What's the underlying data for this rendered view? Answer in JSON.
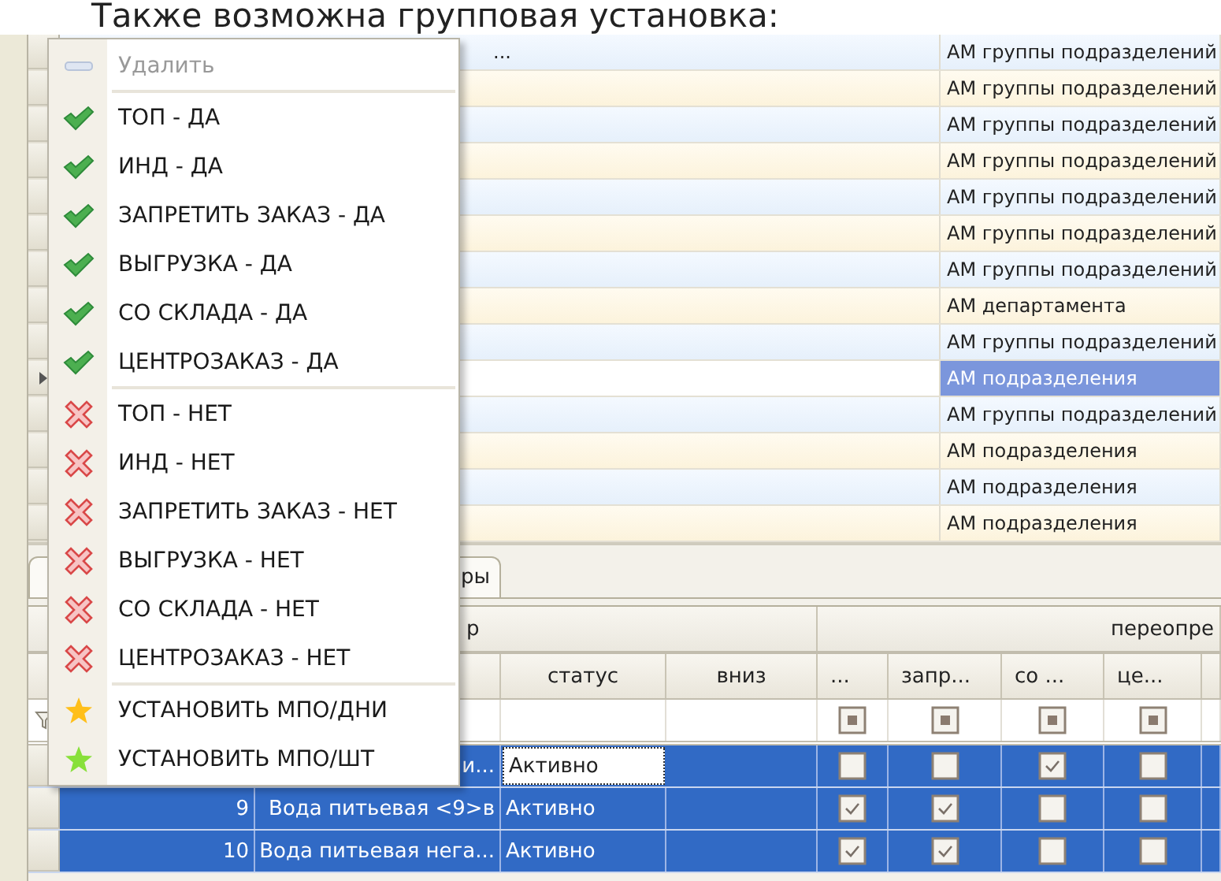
{
  "heading": "Также возможна групповая установка:",
  "top_grid": {
    "rows": [
      {
        "column_2": "...",
        "column_3": "АМ группы подразделений",
        "selected": false
      },
      {
        "column_3": "АМ группы подразделений",
        "selected": false
      },
      {
        "column_3": "АМ группы подразделений",
        "selected": false
      },
      {
        "column_3": "АМ группы подразделений",
        "selected": false
      },
      {
        "column_3": "АМ группы подразделений",
        "selected": false
      },
      {
        "column_3": "АМ группы подразделений",
        "selected": false
      },
      {
        "column_3": "АМ группы подразделений",
        "selected": false
      },
      {
        "column_3": "АМ департамента",
        "selected": false
      },
      {
        "column_3": "АМ группы подразделений",
        "selected": false
      },
      {
        "column_3": "АМ подразделения",
        "selected": true
      },
      {
        "column_3": "АМ группы подразделений",
        "selected": false
      },
      {
        "column_3": "АМ подразделения",
        "selected": false
      },
      {
        "column_3": "АМ подразделения",
        "selected": false
      },
      {
        "column_3": "АМ подразделения",
        "selected": false
      }
    ]
  },
  "tabs": [
    {
      "label": "ры",
      "selected": true
    }
  ],
  "bottom_grid": {
    "groups": [
      {
        "label": "р"
      },
      {
        "label": "переопре"
      }
    ],
    "columns": [
      "статус",
      "вниз",
      "...",
      "запр...",
      "со ...",
      "це..."
    ],
    "rows": [
      {
        "name": "и...",
        "status": "Активно",
        "editing": true,
        "selected": true,
        "checks": [
          false,
          false,
          true,
          false
        ]
      },
      {
        "number": "9",
        "name": "Вода питьевая  <9>в",
        "status": "Активно",
        "editing": false,
        "selected": true,
        "checks": [
          true,
          true,
          false,
          false
        ]
      },
      {
        "number": "10",
        "name": "Вода питьевая нега...",
        "status": "Активно",
        "editing": false,
        "selected": true,
        "checks": [
          true,
          true,
          false,
          false
        ]
      }
    ]
  },
  "context_menu": {
    "groups": [
      [
        {
          "label": "Удалить",
          "kind": "remove",
          "disabled": true
        }
      ],
      [
        {
          "label": "ТОП - ДА",
          "kind": "yes",
          "disabled": false
        },
        {
          "label": "ИНД - ДА",
          "kind": "yes",
          "disabled": false
        },
        {
          "label": "ЗАПРЕТИТЬ ЗАКАЗ - ДА",
          "kind": "yes",
          "disabled": false
        },
        {
          "label": "ВЫГРУЗКА - ДА",
          "kind": "yes",
          "disabled": false
        },
        {
          "label": "СО СКЛАДА - ДА",
          "kind": "yes",
          "disabled": false
        },
        {
          "label": "ЦЕНТРОЗАКАЗ - ДА",
          "kind": "yes",
          "disabled": false
        }
      ],
      [
        {
          "label": "ТОП - НЕТ",
          "kind": "no",
          "disabled": false
        },
        {
          "label": "ИНД - НЕТ",
          "kind": "no",
          "disabled": false
        },
        {
          "label": "ЗАПРЕТИТЬ ЗАКАЗ - НЕТ",
          "kind": "no",
          "disabled": false
        },
        {
          "label": "ВЫГРУЗКА - НЕТ",
          "kind": "no",
          "disabled": false
        },
        {
          "label": "СО СКЛАДА - НЕТ",
          "kind": "no",
          "disabled": false
        },
        {
          "label": "ЦЕНТРОЗАКАЗ - НЕТ",
          "kind": "no",
          "disabled": false
        }
      ],
      [
        {
          "label": "УСТАНОВИТЬ МПО/ДНИ",
          "kind": "set",
          "color": "#ffbf1a",
          "disabled": false
        },
        {
          "label": "УСТАНОВИТЬ МПО/ШТ",
          "kind": "set",
          "color": "#88e03a",
          "disabled": false
        }
      ]
    ]
  }
}
